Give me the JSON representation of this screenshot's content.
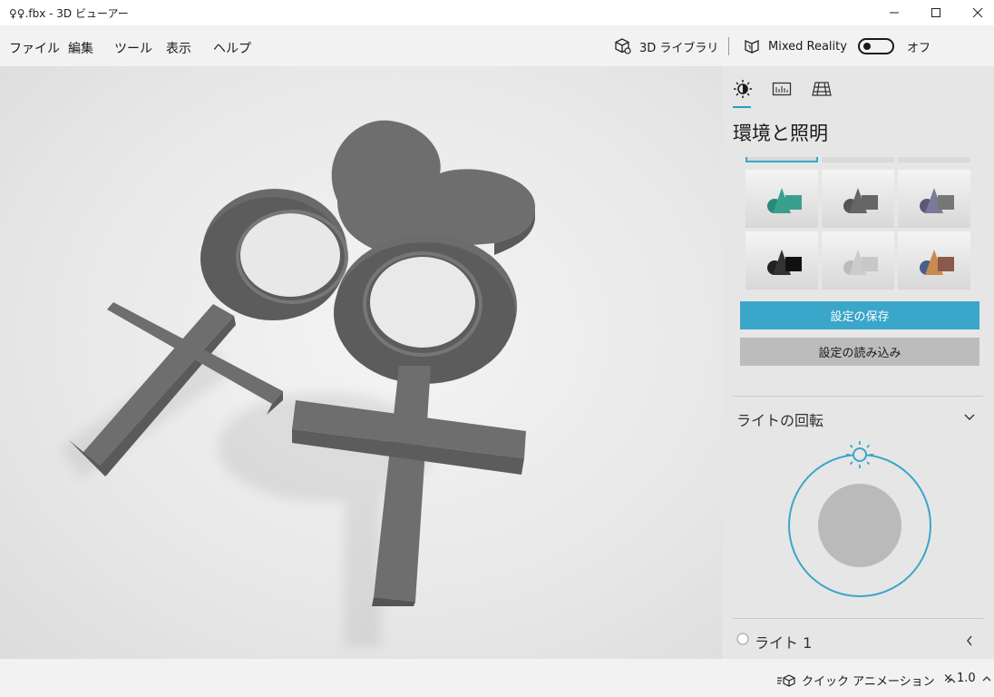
{
  "window": {
    "title": "♀♀.fbx - 3D ビューアー"
  },
  "menu": {
    "items": [
      "ファイル",
      "編集",
      "ツール",
      "表示",
      "ヘルプ"
    ]
  },
  "toolbar": {
    "library_label": "3D ライブラリ",
    "mixed_reality_label": "Mixed Reality",
    "mixed_reality_state": "オフ"
  },
  "panel": {
    "tabs": [
      "environment-tab",
      "stats-tab",
      "grid-tab"
    ],
    "title": "環境と照明",
    "save_button": "設定の保存",
    "load_button": "設定の読み込み",
    "light_rotation_title": "ライトの回転",
    "light_item_label": "ライト 1",
    "accent_color": "#3aa6c9"
  },
  "status": {
    "animation_label": "クイック アニメーション",
    "speed_label": "× 1.0"
  },
  "icons": {
    "library": "cube-library-icon",
    "mixed_reality": "mixed-reality-icon",
    "sun": "sun-icon",
    "chevron_down": "chevron-down-icon",
    "chevron_left": "chevron-left-icon",
    "chevron_up": "chevron-up-icon"
  }
}
